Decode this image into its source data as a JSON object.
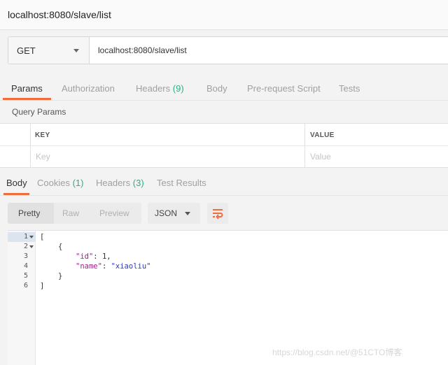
{
  "window": {
    "title": "localhost:8080/slave/list"
  },
  "request": {
    "method": "GET",
    "url": "localhost:8080/slave/list"
  },
  "request_tabs": {
    "params": "Params",
    "authorization": "Authorization",
    "headers": "Headers",
    "headers_count": "(9)",
    "body": "Body",
    "prerequest": "Pre-request Script",
    "tests": "Tests"
  },
  "query_params": {
    "title": "Query Params",
    "key_header": "KEY",
    "value_header": "VALUE",
    "key_placeholder": "Key",
    "value_placeholder": "Value"
  },
  "response_tabs": {
    "body": "Body",
    "cookies": "Cookies",
    "cookies_count": "(1)",
    "headers": "Headers",
    "headers_count": "(3)",
    "test_results": "Test Results"
  },
  "response_toolbar": {
    "pretty": "Pretty",
    "raw": "Raw",
    "preview": "Preview",
    "format": "JSON",
    "wrap_icon": "wrap-lines-icon"
  },
  "response_body": {
    "line_numbers": [
      "1",
      "2",
      "3",
      "4",
      "5",
      "6"
    ],
    "open_bracket": "[",
    "open_brace": "{",
    "id_key": "\"id\"",
    "id_value": "1",
    "name_key": "\"name\"",
    "name_value": "\"xiaoliu\"",
    "close_brace": "}",
    "close_bracket": "]"
  },
  "watermark": "https://blog.csdn.net/@51CTO博客",
  "colors": {
    "accent": "#f26b3a",
    "count": "#26b47f",
    "json_key": "#a11e8c",
    "json_string": "#2e3ab8"
  }
}
